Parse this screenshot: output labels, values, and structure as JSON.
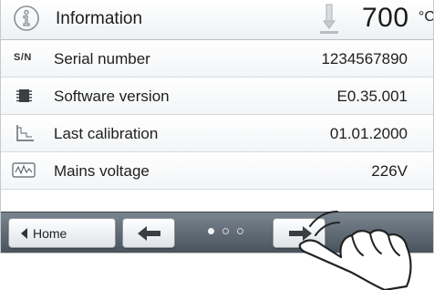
{
  "header": {
    "title": "Information",
    "temperature": "700",
    "temperature_unit": "°C"
  },
  "rows": [
    {
      "icon": "sn-icon",
      "icon_text": "S/N",
      "label": "Serial number",
      "value": "1234567890"
    },
    {
      "icon": "chip-icon",
      "label": "Software version",
      "value": "E0.35.001"
    },
    {
      "icon": "calibration-icon",
      "label": "Last calibration",
      "value": "01.01.2000"
    },
    {
      "icon": "voltage-icon",
      "label": "Mains voltage",
      "value": "226V"
    }
  ],
  "footer": {
    "home_label": "Home",
    "pages_total": 3,
    "current_page": 1
  },
  "colors": {
    "footer_bg": "#5c656f",
    "row_divider": "#d5d9de"
  }
}
